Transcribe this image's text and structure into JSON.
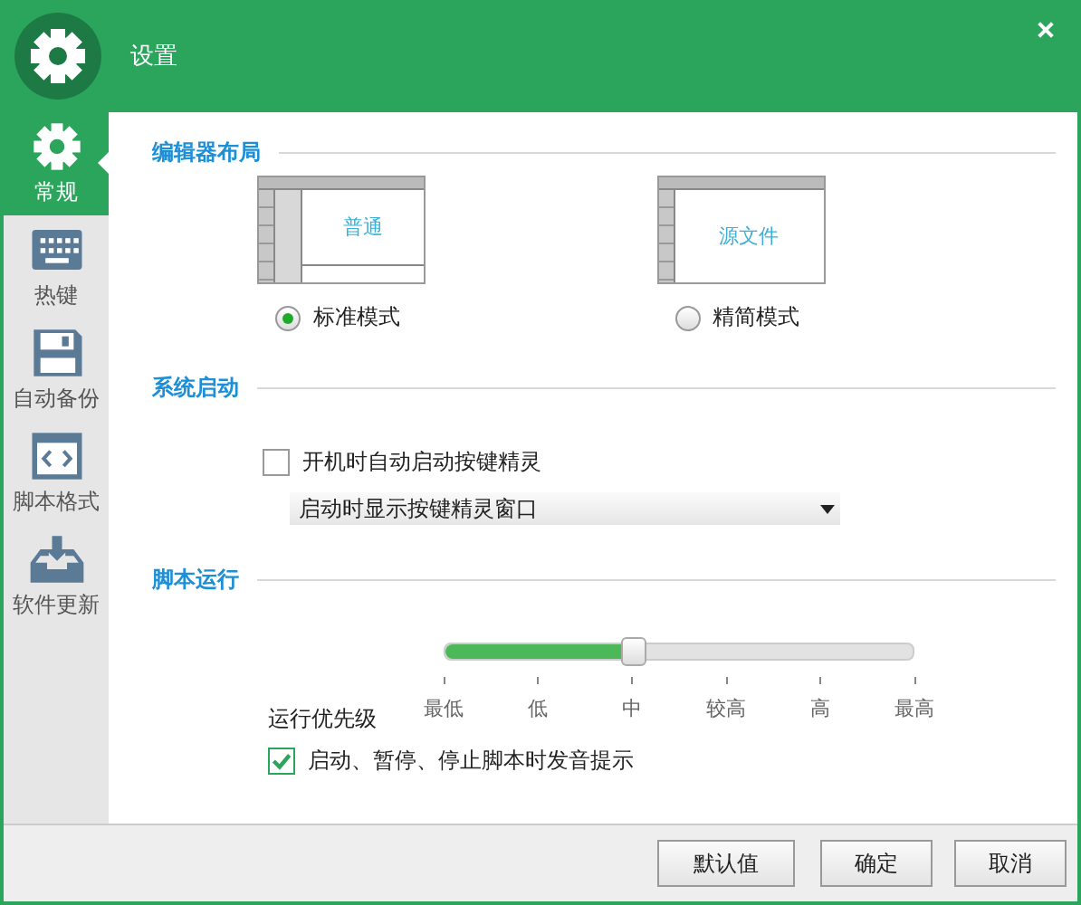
{
  "window": {
    "title": "设置"
  },
  "sidebar": {
    "items": [
      {
        "label": "常规",
        "kind": "gear",
        "selected": true
      },
      {
        "label": "热键",
        "kind": "keyboard",
        "selected": false
      },
      {
        "label": "自动备份",
        "kind": "floppy",
        "selected": false
      },
      {
        "label": "脚本格式",
        "kind": "code",
        "selected": false
      },
      {
        "label": "软件更新",
        "kind": "download",
        "selected": false
      }
    ]
  },
  "editor_layout": {
    "title": "编辑器布局",
    "options": [
      {
        "kind": "standard",
        "preview_label": "普通",
        "label": "标准模式",
        "selected": true
      },
      {
        "kind": "compact",
        "preview_label": "源文件",
        "label": "精简模式",
        "selected": false
      }
    ]
  },
  "system_startup": {
    "title": "系统启动",
    "checkbox": {
      "label": "开机时自动启动按键精灵",
      "checked": false
    },
    "dropdown": {
      "value": "启动时显示按键精灵窗口"
    }
  },
  "script_run": {
    "title": "脚本运行",
    "slider": {
      "label": "运行优先级",
      "level": 0.4,
      "ticks": [
        "最低",
        "低",
        "中",
        "较高",
        "高",
        "最高"
      ]
    },
    "checkbox": {
      "label": "启动、暂停、停止脚本时发音提示",
      "checked": true
    }
  },
  "buttons": [
    "默认值",
    "确定",
    "取消"
  ]
}
